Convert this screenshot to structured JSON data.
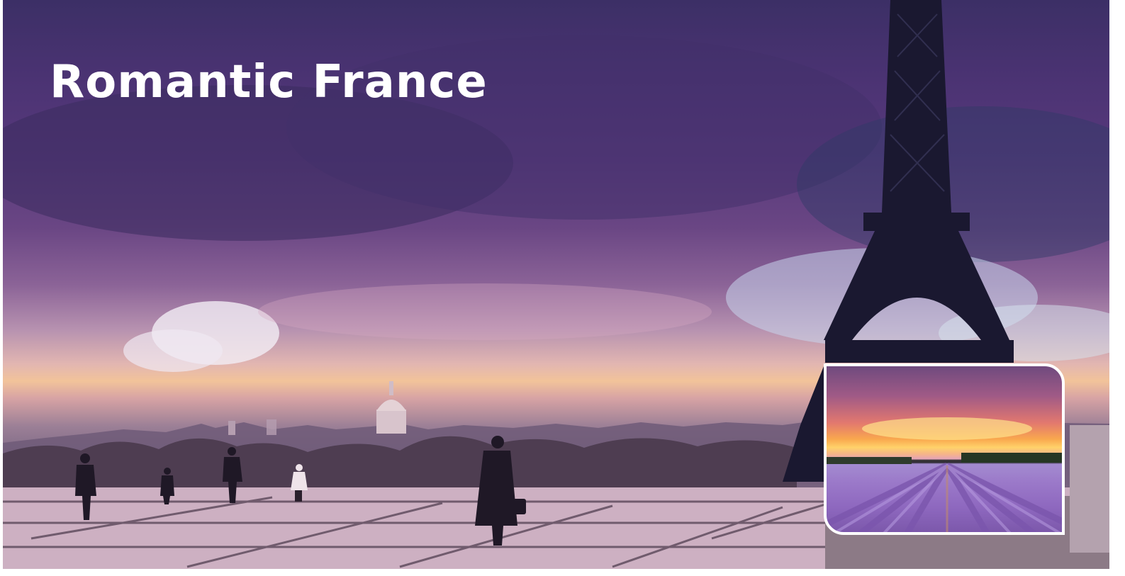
{
  "poster": {
    "title": "Romantic France"
  },
  "colors": {
    "sky_top": "#3c2f66",
    "sky_mid": "#6a4684",
    "horizon_glow": "#f2c39a",
    "plaza": "#c7a6b8",
    "tower": "#1a1830",
    "inset_border": "#ffffff",
    "lavender": "#9b79c9",
    "title_text": "#ffffff"
  },
  "icons": {
    "landmark": "eiffel-tower",
    "dome": "invalides-dome"
  }
}
